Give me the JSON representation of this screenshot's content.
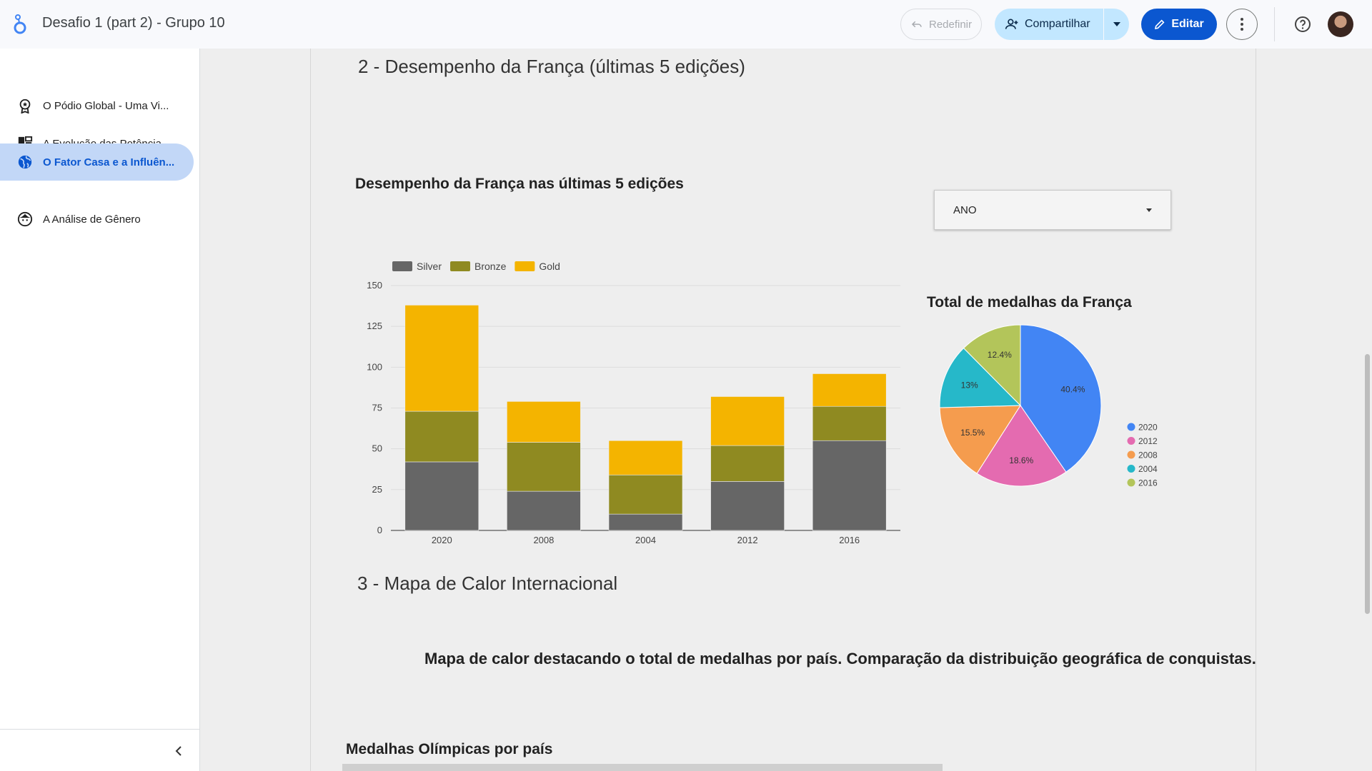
{
  "header": {
    "title": "Desafio 1 (part 2) - Grupo 10",
    "reset_label": "Redefinir",
    "share_label": "Compartilhar",
    "edit_label": "Editar"
  },
  "sidebar": {
    "items": [
      {
        "label": "O Pódio Global - Uma Vi...",
        "icon": "award-icon"
      },
      {
        "label": "A Evolução das Potência...",
        "icon": "dashboard-icon"
      },
      {
        "label": "O Fator Casa e a Influên...",
        "icon": "globe-icon",
        "active": true
      },
      {
        "label": "A Análise de Gênero",
        "icon": "face-icon"
      }
    ]
  },
  "report": {
    "section2_title": "2 - Desempenho da França (últimas 5 edições)",
    "bar_chart_title": "Desempenho da França nas últimas 5 edições",
    "filter_label": "ANO",
    "pie_chart_title": "Total de medalhas da França",
    "section3_title": "3 - Mapa de Calor Internacional",
    "section3_description": "Mapa de calor destacando o total de medalhas por país. Comparação da distribuição geográfica de conquistas.",
    "map_title": "Medalhas Olímpicas por país"
  },
  "colors": {
    "accent": "#0b57d0",
    "silver": "#666666",
    "bronze": "#8f8a21",
    "gold": "#f4b400"
  },
  "chart_data": [
    {
      "type": "bar",
      "stacked": true,
      "title": "Desempenho da França nas últimas 5 edições",
      "categories": [
        "2020",
        "2008",
        "2004",
        "2012",
        "2016"
      ],
      "series": [
        {
          "name": "Silver",
          "color": "#666666",
          "values": [
            42,
            24,
            10,
            30,
            55
          ]
        },
        {
          "name": "Bronze",
          "color": "#8f8a21",
          "values": [
            31,
            30,
            24,
            22,
            21
          ]
        },
        {
          "name": "Gold",
          "color": "#f4b400",
          "values": [
            65,
            25,
            21,
            30,
            20
          ]
        }
      ],
      "ylim": [
        0,
        150
      ],
      "yticks": [
        0,
        25,
        50,
        75,
        100,
        125,
        150
      ],
      "legend": "top-left",
      "grid": true
    },
    {
      "type": "pie",
      "title": "Total de medalhas da França",
      "slices": [
        {
          "label": "2020",
          "value": 40.4,
          "text": "40.4%",
          "color": "#4285f4"
        },
        {
          "label": "2012",
          "value": 18.6,
          "text": "18.6%",
          "color": "#e46bb0"
        },
        {
          "label": "2008",
          "value": 15.5,
          "text": "15.5%",
          "color": "#f59c4e"
        },
        {
          "label": "2004",
          "value": 13.0,
          "text": "13%",
          "color": "#26b8c9"
        },
        {
          "label": "2016",
          "value": 12.4,
          "text": "12.4%",
          "color": "#b3c55a"
        }
      ],
      "legend": "right"
    }
  ]
}
